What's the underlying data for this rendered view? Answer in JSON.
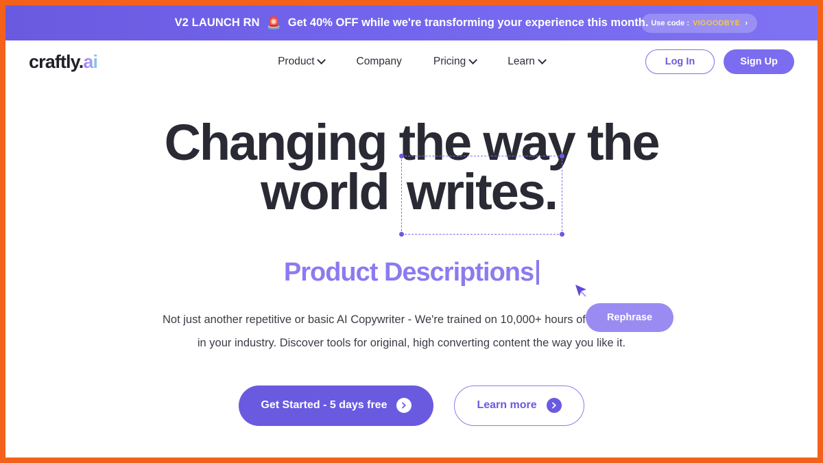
{
  "theme": {
    "border_orange": "#F4611A",
    "primary_purple": "#6A5AE0",
    "light_purple": "#8B7BF0",
    "rephrase_purple": "#9A8BF2",
    "headline_dark": "#2A2A35",
    "code_gold": "#F2C94C",
    "page_background": "#FFFFFF"
  },
  "promo": {
    "strong": "V2 LAUNCH RN",
    "emoji": "🚨",
    "message": "Get 40% OFF while we're transforming your experience this month.",
    "code_label": "Use code :",
    "code_value": "VIGOODBYE",
    "chevron": "›"
  },
  "nav": {
    "brand_primary": "craftly.",
    "brand_accent": "ai",
    "links": [
      {
        "label": "Product",
        "has_dropdown": true
      },
      {
        "label": "Company",
        "has_dropdown": false
      },
      {
        "label": "Pricing",
        "has_dropdown": true
      },
      {
        "label": "Learn",
        "has_dropdown": true
      }
    ],
    "login_label": "Log In",
    "signup_label": "Sign Up"
  },
  "hero": {
    "headline_line1": "Changing the way the",
    "headline_line2_prefix": "world ",
    "headline_line2_selected": "writes.",
    "rephrase_label": "Rephrase",
    "subheadline": "Product Descriptions",
    "paragraph": "Not just another repetitive or basic AI Copywriter - We're trained on 10,000+ hours of expert content in your industry. Discover tools for original, high converting content the way you like it.",
    "cta_primary": "Get Started - 5 days free",
    "cta_secondary": "Learn more"
  }
}
